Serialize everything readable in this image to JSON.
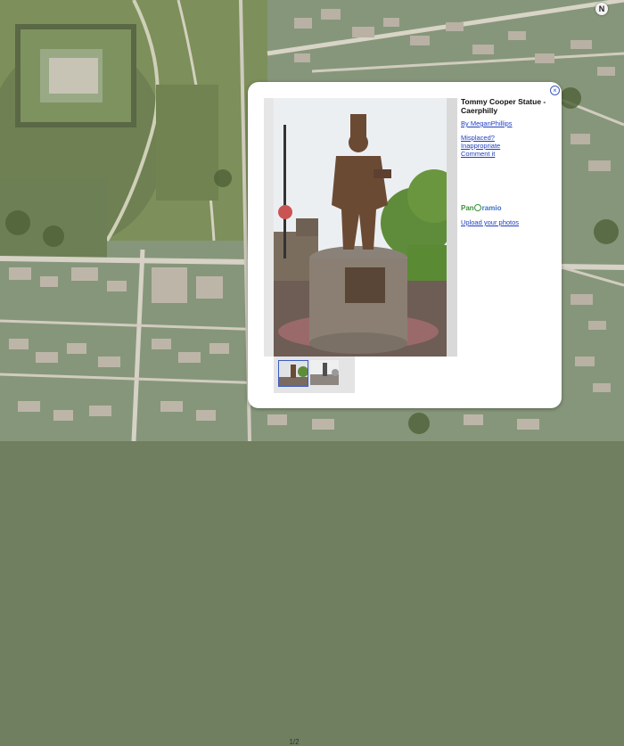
{
  "map": {
    "compass_label": "N",
    "colors": {
      "fields": "#7a8c5d",
      "water": "#5f6f4a",
      "roads": "#d8d4c8",
      "roofs": "#b9b2a6"
    }
  },
  "popup": {
    "close_symbol": "×",
    "title": "Tommy Cooper Statue - Caerphilly",
    "author": "By MeganPhillips",
    "links": {
      "misplaced": "Misplaced?",
      "inappropriate": "Inappropriate",
      "comment": "Comment it"
    },
    "brand": {
      "part1": "Pan",
      "part2": "ramio"
    },
    "upload": "Upload your photos",
    "thumb_count": "1/2"
  }
}
